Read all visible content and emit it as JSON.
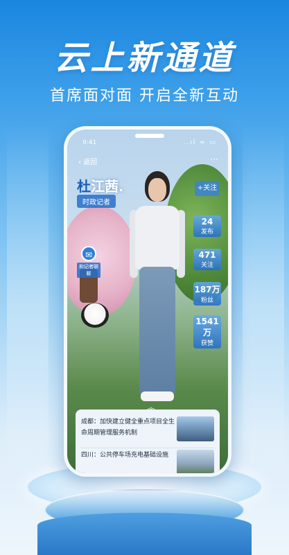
{
  "promo": {
    "headline": "云上新通道",
    "subline": "首席面对面 开启全新互动"
  },
  "status_bar": {
    "time": "9:41",
    "icons": "..ıl ≈ ▭"
  },
  "nav": {
    "back_label": "返回",
    "back_glyph": "‹",
    "more_label": "···"
  },
  "reporter": {
    "name_first": "杜",
    "name_rest": "江茜",
    "name_suffix": ".",
    "role": "时政记者"
  },
  "actions": {
    "follow_label": "+关注",
    "chat_icon_glyph": "✉",
    "chat_label": "和记者聊聊"
  },
  "stats": [
    {
      "value": "24",
      "label": "发布"
    },
    {
      "value": "471",
      "label": "关注"
    },
    {
      "value": "187万",
      "label": "粉丝"
    },
    {
      "value": "1541万",
      "label": "获赞"
    }
  ],
  "expand_glyph": "︽",
  "news": [
    {
      "text": "成都：加快建立健全重点项目全生命周期管理服务机制"
    },
    {
      "text": "四川：公共停车场充电基础设施"
    }
  ]
}
